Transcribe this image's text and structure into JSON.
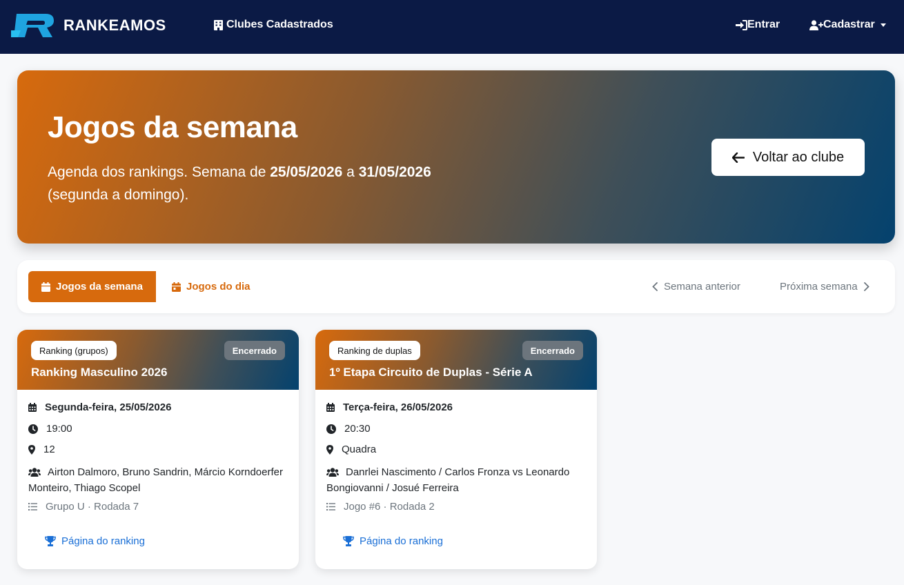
{
  "nav": {
    "brand": "RANKEAMOS",
    "clubs": "Clubes Cadastrados",
    "enter": "Entrar",
    "register": "Cadastrar"
  },
  "hero": {
    "title": "Jogos da semana",
    "desc_prefix": "Agenda dos rankings. Semana de ",
    "start_date": "25/05/2026",
    "desc_mid": " a ",
    "end_date": "31/05/2026",
    "desc_suffix": " (segunda a domingo).",
    "back_label": "Voltar ao clube"
  },
  "tabs": {
    "week": "Jogos da semana",
    "day": "Jogos do dia",
    "prev_week": "Semana anterior",
    "next_week": "Próxima semana"
  },
  "cards": [
    {
      "type": "Ranking (grupos)",
      "status": "Encerrado",
      "title": "Ranking Masculino 2026",
      "date": "Segunda-feira, 25/05/2026",
      "time": "19:00",
      "place": "12",
      "players": "Airton Dalmoro, Bruno Sandrin, Márcio Korndoerfer Monteiro, Thiago Scopel",
      "group": "Grupo U · Rodada 7",
      "link": "Página do ranking"
    },
    {
      "type": "Ranking de duplas",
      "status": "Encerrado",
      "title": "1º Etapa Circuito de Duplas - Série A",
      "date": "Terça-feira, 26/05/2026",
      "time": "20:30",
      "place": "Quadra",
      "players": "Danrlei Nascimento / Carlos Fronza vs Leonardo Bongiovanni / Josué Ferreira",
      "group": "Jogo #6 · Rodada 2",
      "link": "Página do ranking"
    }
  ],
  "colors": {
    "navbar": "#0b1a45",
    "accent": "#d76a0d",
    "link": "#1a6fd6",
    "status_badge": "#6c757d"
  }
}
